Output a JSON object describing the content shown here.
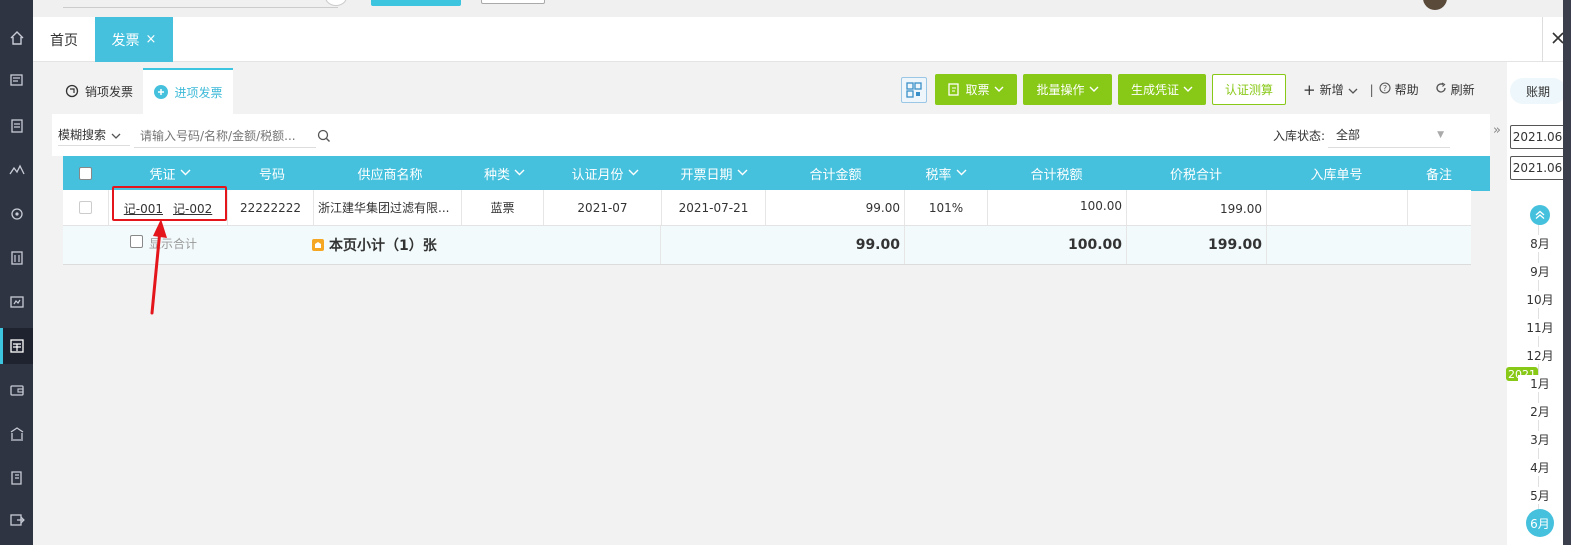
{
  "colors": {
    "accent": "#45c1dd",
    "green": "#88c817",
    "highlight_red": "#e4161b",
    "rail": "#2f3443"
  },
  "rail": {
    "icons": [
      "home-icon",
      "voucher-icon",
      "document-icon",
      "chart-icon",
      "settings-icon",
      "building-icon",
      "report-icon",
      "invoice-icon",
      "wallet-icon",
      "bank-icon",
      "ledger-icon",
      "tax-icon",
      "export-icon"
    ]
  },
  "tabs": {
    "home": "首页",
    "invoice": "发票",
    "close": "×"
  },
  "subtabs": {
    "sales": "销项发票",
    "purchase": "进项发票"
  },
  "toolbar": {
    "fetch": "取票",
    "batch": "批量操作",
    "generate_voucher": "生成凭证",
    "certify_calc": "认证测算",
    "add": "新增",
    "help": "帮助",
    "refresh": "刷新",
    "separator": "|"
  },
  "search": {
    "mode": "模糊搜索",
    "placeholder": "请输入号码/名称/金额/税额..."
  },
  "warehouse_status": {
    "label": "入库状态:",
    "value": "全部"
  },
  "table": {
    "headers": {
      "voucher": "凭证",
      "number": "号码",
      "supplier": "供应商名称",
      "type": "种类",
      "cert_month": "认证月份",
      "issue_date": "开票日期",
      "amount": "合计金额",
      "tax_rate": "税率",
      "tax": "合计税额",
      "total": "价税合计",
      "warehouse_no": "入库单号",
      "remark": "备注"
    },
    "rows": [
      {
        "voucher_1": "记-001",
        "voucher_2": "记-002",
        "number": "22222222",
        "supplier": "浙江建华集团过滤有限...",
        "type": "蓝票",
        "cert_month": "2021-07",
        "issue_date": "2021-07-21",
        "amount": "99.00",
        "tax_rate": "101%",
        "tax": "100.00",
        "total": "199.00",
        "warehouse_no": "",
        "remark": ""
      }
    ],
    "subtotal": {
      "show_label": "显示合计",
      "label": "本页小计（1）张",
      "amount": "99.00",
      "tax": "100.00",
      "total": "199.00"
    }
  },
  "period": {
    "title": "账期",
    "start": "2021.06",
    "end": "2021.06",
    "year": "2021",
    "months_before": [
      "8月",
      "9月",
      "10月",
      "11月",
      "12月"
    ],
    "months_after": [
      "1月",
      "2月",
      "3月",
      "4月",
      "5月"
    ],
    "current": "6月"
  }
}
